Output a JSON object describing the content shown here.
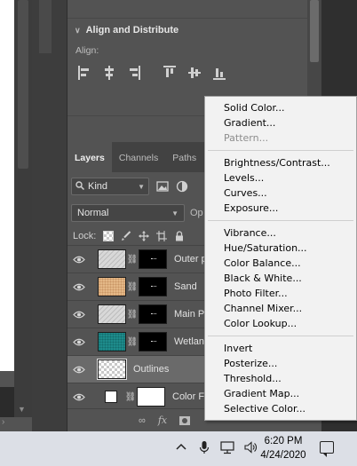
{
  "properties": {
    "section_title": "Align and Distribute",
    "align_label": "Align:",
    "align_icons": [
      "align-left-edges-icon",
      "align-horizontal-centers-icon",
      "align-right-edges-icon",
      "align-top-edges-icon",
      "align-vertical-centers-icon",
      "align-bottom-edges-icon"
    ]
  },
  "layers_panel": {
    "tabs": [
      "Layers",
      "Channels",
      "Paths"
    ],
    "active_tab": "Layers",
    "filter_kind": "Kind",
    "blend_mode": "Normal",
    "opacity_label": "Op",
    "lock_label": "Lock:",
    "layers": [
      {
        "name": "Outer p",
        "thumb": "sketch",
        "mask": true,
        "selected": false
      },
      {
        "name": "Sand",
        "thumb": "sand",
        "mask": true,
        "selected": false
      },
      {
        "name": "Main P",
        "thumb": "sketch",
        "mask": true,
        "selected": false
      },
      {
        "name": "Wetlan",
        "thumb": "teal",
        "mask": true,
        "selected": false
      },
      {
        "name": "Outlines",
        "thumb": "transparent",
        "mask": false,
        "selected": true
      },
      {
        "name": "Color Fi",
        "thumb": "white",
        "mask": true,
        "selected": false
      }
    ],
    "footer_fx": "fx"
  },
  "context_menu": {
    "groups": [
      [
        {
          "label": "Solid Color...",
          "enabled": true
        },
        {
          "label": "Gradient...",
          "enabled": true
        },
        {
          "label": "Pattern...",
          "enabled": false
        }
      ],
      [
        {
          "label": "Brightness/Contrast...",
          "enabled": true
        },
        {
          "label": "Levels...",
          "enabled": true
        },
        {
          "label": "Curves...",
          "enabled": true
        },
        {
          "label": "Exposure...",
          "enabled": true
        }
      ],
      [
        {
          "label": "Vibrance...",
          "enabled": true
        },
        {
          "label": "Hue/Saturation...",
          "enabled": true
        },
        {
          "label": "Color Balance...",
          "enabled": true
        },
        {
          "label": "Black & White...",
          "enabled": true
        },
        {
          "label": "Photo Filter...",
          "enabled": true
        },
        {
          "label": "Channel Mixer...",
          "enabled": true
        },
        {
          "label": "Color Lookup...",
          "enabled": true
        }
      ],
      [
        {
          "label": "Invert",
          "enabled": true
        },
        {
          "label": "Posterize...",
          "enabled": true
        },
        {
          "label": "Threshold...",
          "enabled": true
        },
        {
          "label": "Gradient Map...",
          "enabled": true
        },
        {
          "label": "Selective Color...",
          "enabled": true
        }
      ]
    ]
  },
  "taskbar": {
    "time": "6:20 PM",
    "date": "4/24/2020"
  },
  "colors": {
    "panel_bg": "#535353",
    "menu_bg": "#f2f2f2",
    "taskbar_bg": "#dcdfe6",
    "selected_row": "#6a6a6a"
  }
}
